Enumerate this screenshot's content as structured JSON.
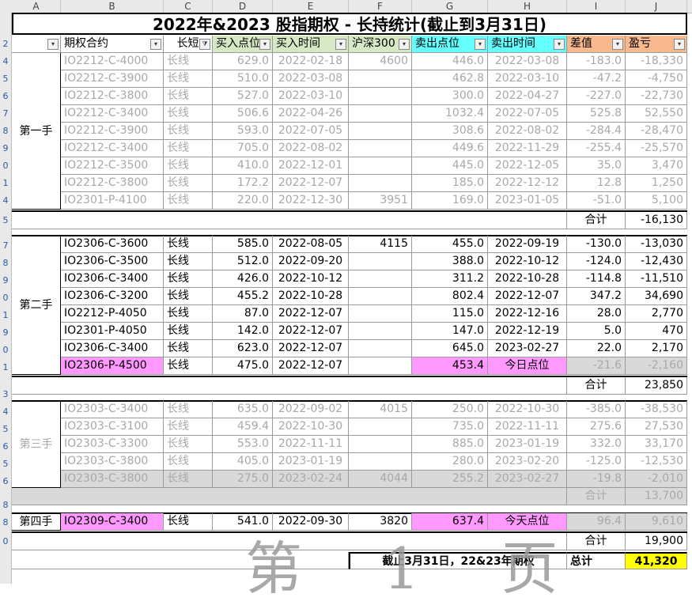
{
  "sheet": {
    "columns": [
      "A",
      "B",
      "C",
      "D",
      "E",
      "F",
      "G",
      "H",
      "I",
      "J"
    ],
    "row_numbers": [
      "2",
      "4",
      "5",
      "6",
      "7",
      "8",
      "9",
      "0",
      "1",
      "4",
      "5",
      "7",
      "8",
      "9",
      "0",
      "1",
      "9",
      "0",
      "1",
      "3",
      "4",
      "5",
      "6",
      "5",
      "6",
      "8",
      "8",
      "0"
    ],
    "title": "2022年&2023 股指期权 - 长持统计(截止到3月31日)",
    "headers": [
      "期权合约",
      "长短",
      "买入点位",
      "买入时间",
      "沪深300",
      "卖出点位",
      "卖出时间",
      "差值",
      "盈亏"
    ],
    "group1": {
      "label": "第一手",
      "rows": [
        [
          "IO2212-C-4000",
          "长线",
          "629.0",
          "2022-02-18",
          "4600",
          "446.0",
          "2022-03-08",
          "-183.0",
          "-18,330"
        ],
        [
          "IO2212-C-3900",
          "长线",
          "510.0",
          "2022-03-08",
          "",
          "462.8",
          "2022-03-10",
          "-47.2",
          "-4,750"
        ],
        [
          "IO2212-C-3800",
          "长线",
          "527.0",
          "2022-03-10",
          "",
          "300.0",
          "2022-04-27",
          "-227.0",
          "-22,730"
        ],
        [
          "IO2212-C-3400",
          "长线",
          "506.6",
          "2022-04-26",
          "",
          "1032.4",
          "2022-07-05",
          "525.8",
          "52,550"
        ],
        [
          "IO2212-C-3900",
          "长线",
          "593.0",
          "2022-07-05",
          "",
          "308.6",
          "2022-08-02",
          "-284.4",
          "-28,470"
        ],
        [
          "IO2212-C-3400",
          "长线",
          "705.0",
          "2022-08-02",
          "",
          "449.6",
          "2022-11-29",
          "-255.4",
          "-25,570"
        ],
        [
          "IO2212-C-3500",
          "长线",
          "410.0",
          "2022-12-01",
          "",
          "445.0",
          "2022-12-05",
          "35.0",
          "3,470"
        ],
        [
          "IO2212-C-3800",
          "长线",
          "172.2",
          "2022-12-07",
          "",
          "185.0",
          "2022-12-12",
          "12.8",
          "1,250"
        ],
        [
          "IO2301-P-4100",
          "长线",
          "220.0",
          "2022-12-30",
          "3951",
          "169.0",
          "2023-01-05",
          "-51.0",
          "5,100"
        ]
      ],
      "total_label": "合计",
      "total": "-16,130"
    },
    "group2": {
      "label": "第二手",
      "rows": [
        [
          "IO2306-C-3600",
          "长线",
          "585.0",
          "2022-08-05",
          "4115",
          "455.0",
          "2022-09-19",
          "-130.0",
          "-13,030"
        ],
        [
          "IO2306-C-3500",
          "长线",
          "512.0",
          "2022-09-20",
          "",
          "388.0",
          "2022-10-12",
          "-124.0",
          "-12,430"
        ],
        [
          "IO2306-C-3400",
          "长线",
          "426.0",
          "2022-10-12",
          "",
          "311.2",
          "2022-10-28",
          "-114.8",
          "-11,510"
        ],
        [
          "IO2306-C-3200",
          "长线",
          "455.2",
          "2022-10-28",
          "",
          "802.4",
          "2022-12-07",
          "347.2",
          "34,690"
        ],
        [
          "IO2212-P-4050",
          "长线",
          "87.0",
          "2022-12-07",
          "",
          "115.0",
          "2022-12-16",
          "28.0",
          "2,770"
        ],
        [
          "IO2301-P-4050",
          "长线",
          "142.0",
          "2022-12-07",
          "",
          "147.0",
          "2022-12-19",
          "5.0",
          "470"
        ],
        [
          "IO2306-C-3400",
          "长线",
          "623.0",
          "2022-12-07",
          "",
          "645.0",
          "2023-02-27",
          "22.0",
          "2,170"
        ],
        [
          "IO2306-P-4500",
          "长线",
          "475.0",
          "2022-12-07",
          "",
          "453.4",
          "今日点位",
          "-21.6",
          "-2,160"
        ]
      ],
      "total_label": "合计",
      "total": "23,850"
    },
    "group3": {
      "label": "第三手",
      "rows": [
        [
          "IO2303-C-3400",
          "长线",
          "635.0",
          "2022-09-02",
          "4015",
          "250.0",
          "2022-10-30",
          "-385.0",
          "-38,530"
        ],
        [
          "IO2303-C-3100",
          "长线",
          "459.4",
          "2022-10-30",
          "",
          "735.0",
          "2022-11-11",
          "275.6",
          "27,530"
        ],
        [
          "IO2303-C-3300",
          "长线",
          "553.0",
          "2022-11-11",
          "",
          "885.0",
          "2023-01-19",
          "332.0",
          "33,170"
        ],
        [
          "IO2303-C-3800",
          "长线",
          "405.0",
          "2023-01-19",
          "",
          "280.0",
          "2023-02-20",
          "-125.0",
          "-12,530"
        ],
        [
          "IO2303-C-3800",
          "长线",
          "275.0",
          "2023-02-24",
          "4044",
          "255.2",
          "2023-02-27",
          "-19.8",
          "-2,010"
        ]
      ],
      "total_label": "合计",
      "total": "13,700"
    },
    "group4": {
      "label": "第四手",
      "rows": [
        [
          "IO2309-C-3400",
          "长线",
          "541.0",
          "2022-09-30",
          "3820",
          "637.4",
          "今天点位",
          "96.4",
          "9,610"
        ]
      ],
      "total_label": "合计",
      "total": "19,900"
    },
    "summary": {
      "label": "截止3月31日，22&23年期权",
      "total_label": "总计",
      "grand_total": "41,320"
    },
    "watermark": "第 1 页",
    "colors": {
      "header_green": "#d6e8c4",
      "header_cyan": "#66ffff",
      "header_orange": "#f9b98e",
      "highlight_pink": "#ff99ff",
      "grand_total_yellow": "#ffff00"
    }
  }
}
